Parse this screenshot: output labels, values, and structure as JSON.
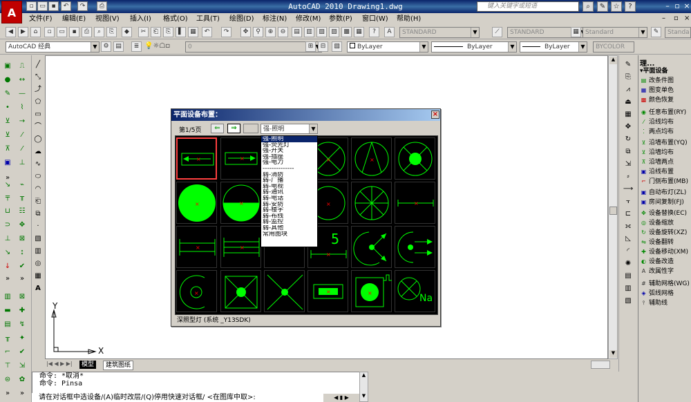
{
  "app": {
    "title": "AutoCAD 2010  Drawing1.dwg",
    "logo": "A",
    "search_placeholder": "键入关键字或短语"
  },
  "menu": [
    "文件(F)",
    "编辑(E)",
    "视图(V)",
    "插入(I)",
    "格式(O)",
    "工具(T)",
    "绘图(D)",
    "标注(N)",
    "修改(M)",
    "参数(P)",
    "窗口(W)",
    "帮助(H)"
  ],
  "toolbar": {
    "text_style": "STANDARD",
    "dim_style": "STANDARD",
    "table_style": "Standard",
    "multileader_style": "Standa",
    "workspace": "AutoCAD 经典",
    "layer": "0",
    "color": "ByLayer",
    "linetype": "ByLayer",
    "lineweight": "ByLayer",
    "plotstyle": "BYCOLOR"
  },
  "tabs": [
    "模型",
    "建筑图纸"
  ],
  "dialog": {
    "title": "平面设备布置：",
    "page": "第1/5页",
    "category": "强-照明",
    "dropdown": [
      "强-照明",
      "强-荧光灯",
      "强-开关",
      "强-插座",
      "强-电力",
      "--------------",
      "弱-消防",
      "弱-广播",
      "弱-电视",
      "弱-通讯",
      "弱-电话",
      "弱-安防",
      "弱-楼宇",
      "弱-布线",
      "弱-监控",
      "弱-其他",
      "常用图块"
    ],
    "status": "深照型灯 (系统 _Y13SDK)",
    "cell_labels": {
      "five": "5",
      "na": "Na"
    }
  },
  "palette": {
    "title": "理...",
    "items": [
      "▾平面设备",
      "改条件图",
      "图变单色",
      "颜色恢复",
      "任意布置(RY)",
      "沿线均布",
      "两点均布",
      "沿墙布置(YQ)",
      "沿墙均布",
      "沿墙两点",
      "沿线布置",
      "门侧布置(MB)",
      "自动布灯(ZL)",
      "房间复制(FJ)",
      "设备替换(EC)",
      "设备缩放",
      "设备旋转(XZ)",
      "设备翻转",
      "设备移动(XM)",
      "设备改造",
      "改属性字",
      "辅助网格(WG)",
      "弧线网格",
      "辅助线"
    ]
  },
  "command": {
    "line1": "命令: *取消*",
    "line2": "命令: Pinsa",
    "prompt": "请在对话框中选设备/(A)临时改层/(Q)停用快速对话框/ <在图库中取>:"
  },
  "axis": {
    "x": "X",
    "y": "Y"
  }
}
